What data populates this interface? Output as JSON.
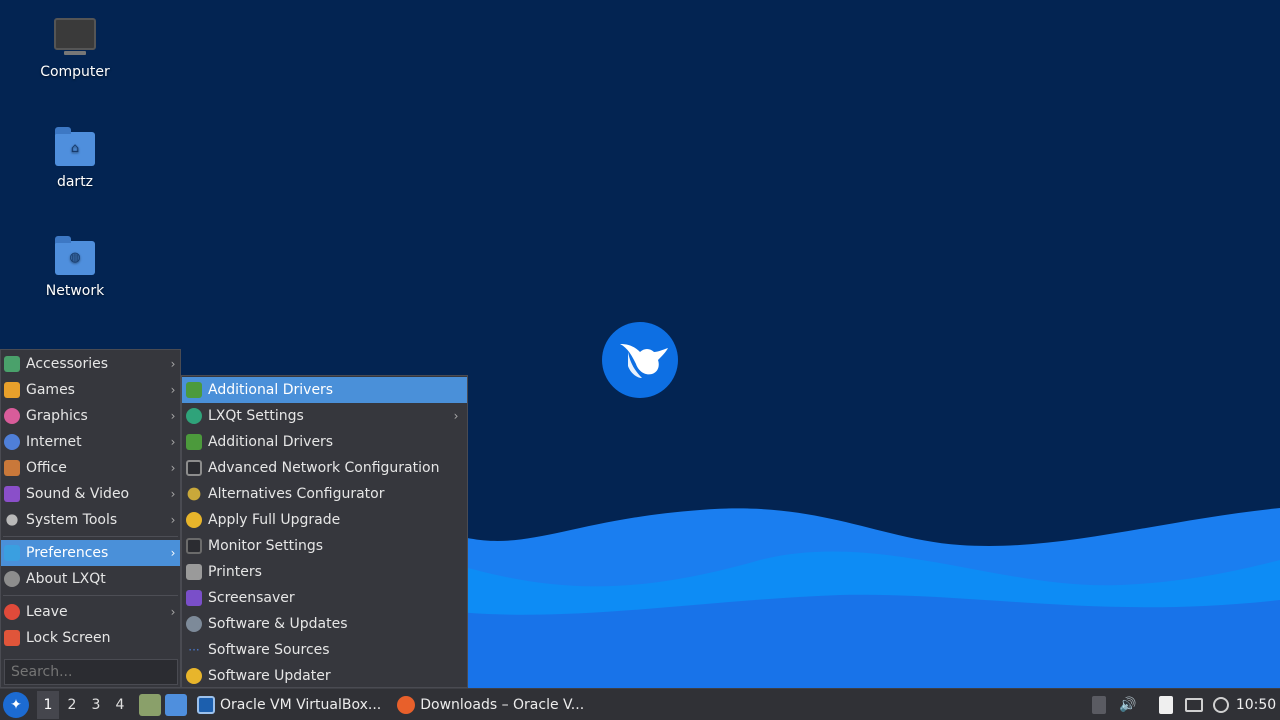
{
  "desktop": {
    "icons": [
      {
        "label": "Computer",
        "icon": "computer-icon"
      },
      {
        "label": "dartz",
        "icon": "home-folder-icon"
      },
      {
        "label": "Network",
        "icon": "network-folder-icon"
      }
    ]
  },
  "start_menu": {
    "items": [
      {
        "label": "Accessories",
        "icon": "accessories-icon",
        "color": "#4aa16b",
        "submenu": true
      },
      {
        "label": "Games",
        "icon": "games-icon",
        "color": "#e8a02b",
        "submenu": true
      },
      {
        "label": "Graphics",
        "icon": "graphics-icon",
        "color": "#d85c9a",
        "submenu": true
      },
      {
        "label": "Internet",
        "icon": "internet-icon",
        "color": "#4f7fd8",
        "submenu": true
      },
      {
        "label": "Office",
        "icon": "office-icon",
        "color": "#c9783a",
        "submenu": true
      },
      {
        "label": "Sound & Video",
        "icon": "sound-video-icon",
        "color": "#8a4fc9",
        "submenu": true
      },
      {
        "label": "System Tools",
        "icon": "system-tools-icon",
        "color": "#b9b9b9",
        "submenu": true
      },
      {
        "label": "Preferences",
        "icon": "preferences-icon",
        "color": "#3a9fe0",
        "submenu": true,
        "selected": true
      },
      {
        "label": "About LXQt",
        "icon": "info-icon",
        "color": "#8d8d8d",
        "submenu": false
      },
      {
        "label": "Leave",
        "icon": "power-icon",
        "color": "#e04a3a",
        "submenu": true
      },
      {
        "label": "Lock Screen",
        "icon": "lock-icon",
        "color": "#e0553a",
        "submenu": false
      }
    ],
    "search_placeholder": "Search..."
  },
  "preferences_menu": {
    "items": [
      {
        "label": "Additional Drivers",
        "icon": "chip-icon",
        "color": "#4c9a3c",
        "selected": true
      },
      {
        "label": "LXQt Settings",
        "icon": "lxqt-icon",
        "color": "#2fa37a",
        "submenu": true
      },
      {
        "label": "Additional Drivers",
        "icon": "chip-icon",
        "color": "#4c9a3c"
      },
      {
        "label": "Advanced Network Configuration",
        "icon": "network-monitor-icon",
        "color": "#8d8d8d"
      },
      {
        "label": "Alternatives Configurator",
        "icon": "alternatives-icon",
        "color": "#c9a83a"
      },
      {
        "label": "Apply Full Upgrade",
        "icon": "upgrade-icon",
        "color": "#e8b52b"
      },
      {
        "label": "Monitor Settings",
        "icon": "monitor-icon",
        "color": "#6b6b6b"
      },
      {
        "label": "Printers",
        "icon": "printer-icon",
        "color": "#9a9a9a"
      },
      {
        "label": "Screensaver",
        "icon": "screensaver-icon",
        "color": "#7a4fc9"
      },
      {
        "label": "Software & Updates",
        "icon": "software-updates-icon",
        "color": "#7d8a99"
      },
      {
        "label": "Software Sources",
        "icon": "software-sources-icon",
        "color": "#4a7ad0"
      },
      {
        "label": "Software Updater",
        "icon": "updater-icon",
        "color": "#e8b52b"
      }
    ]
  },
  "taskbar": {
    "workspaces": [
      "1",
      "2",
      "3",
      "4"
    ],
    "active_workspace": "1",
    "tasks": [
      {
        "label": "Oracle VM VirtualBox...",
        "icon": "virtualbox-icon",
        "color": "#1c5fae"
      },
      {
        "label": "Downloads – Oracle V...",
        "icon": "firefox-icon",
        "color": "#e8602b"
      }
    ],
    "clock": "10:50"
  },
  "colors": {
    "wallpaper": "#032452",
    "wave_light": "#0f86f0",
    "wave_mid": "#1579e8",
    "menu_bg": "#36373d",
    "selection": "#4a90d9",
    "taskbar": "#303136"
  }
}
